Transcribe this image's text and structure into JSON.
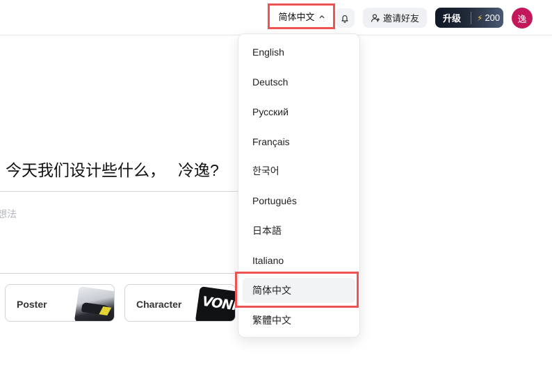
{
  "header": {
    "language_button": {
      "label": "简体中文",
      "icon": "chevron-up-icon"
    },
    "notification_icon": "bell-icon",
    "invite_button": {
      "label": "邀请好友",
      "icon": "user-plus-icon"
    },
    "upgrade_button": {
      "label": "升级",
      "credits": "200",
      "icon": "bolt-icon"
    },
    "avatar_text": "逸"
  },
  "main": {
    "greeting": "今天我们设计些什么，",
    "greeting_name": "冷逸?",
    "prompt_placeholder": "想法",
    "cards": [
      {
        "label": "Poster"
      },
      {
        "label": "Character",
        "thumb_text": "VONIC"
      }
    ]
  },
  "language_menu": {
    "items": [
      "English",
      "Deutsch",
      "Русский",
      "Français",
      "한국어",
      "Português",
      "日本語",
      "Italiano",
      "简体中文",
      "繁體中文"
    ],
    "selected": "简体中文"
  },
  "colors": {
    "highlight": "#ef5350",
    "avatar_bg": "#c2185b",
    "bolt": "#f7c948"
  }
}
